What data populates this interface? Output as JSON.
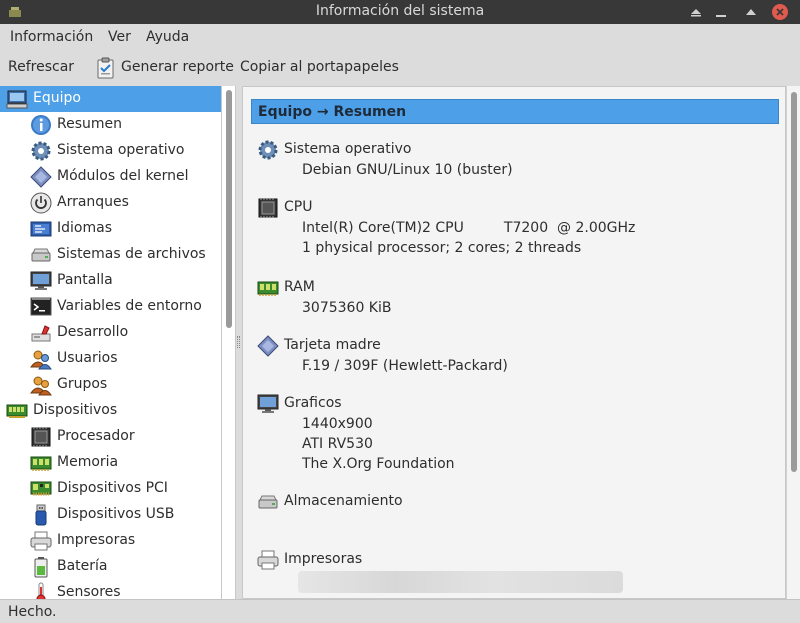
{
  "window": {
    "title": "Información del sistema"
  },
  "menubar": {
    "items": [
      "Información",
      "Ver",
      "Ayuda"
    ]
  },
  "toolbar": {
    "refresh_label": "Refrescar",
    "report_label": "Generar reporte",
    "copy_label": "Copiar al portapapeles"
  },
  "sidebar": {
    "items": [
      {
        "label": "Equipo",
        "icon": "computer-icon",
        "level": 0,
        "selected": true
      },
      {
        "label": "Resumen",
        "icon": "info-icon",
        "level": 1
      },
      {
        "label": "Sistema operativo",
        "icon": "gear-icon",
        "level": 1
      },
      {
        "label": "Módulos del kernel",
        "icon": "kernel-module-icon",
        "level": 1
      },
      {
        "label": "Arranques",
        "icon": "power-icon",
        "level": 1
      },
      {
        "label": "Idiomas",
        "icon": "language-icon",
        "level": 1
      },
      {
        "label": "Sistemas de archivos",
        "icon": "drive-icon",
        "level": 1
      },
      {
        "label": "Pantalla",
        "icon": "monitor-icon",
        "level": 1
      },
      {
        "label": "Variables de entorno",
        "icon": "terminal-icon",
        "level": 1
      },
      {
        "label": "Desarrollo",
        "icon": "development-icon",
        "level": 1
      },
      {
        "label": "Usuarios",
        "icon": "user-icon",
        "level": 1
      },
      {
        "label": "Grupos",
        "icon": "group-icon",
        "level": 1
      },
      {
        "label": "Dispositivos",
        "icon": "devices-icon",
        "level": 0
      },
      {
        "label": "Procesador",
        "icon": "cpu-icon",
        "level": 1
      },
      {
        "label": "Memoria",
        "icon": "memory-icon",
        "level": 1
      },
      {
        "label": "Dispositivos PCI",
        "icon": "pci-icon",
        "level": 1
      },
      {
        "label": "Dispositivos USB",
        "icon": "usb-icon",
        "level": 1
      },
      {
        "label": "Impresoras",
        "icon": "printer-icon",
        "level": 1
      },
      {
        "label": "Batería",
        "icon": "battery-icon",
        "level": 1
      },
      {
        "label": "Sensores",
        "icon": "sensor-icon",
        "level": 1
      }
    ]
  },
  "content": {
    "header": "Equipo → Resumen",
    "sections": [
      {
        "title": "Sistema operativo",
        "icon": "gear-icon",
        "values": [
          "Debian GNU/Linux 10 (buster)"
        ]
      },
      {
        "title": "CPU",
        "icon": "cpu-icon",
        "values": [
          "Intel(R) Core(TM)2 CPU         T7200  @ 2.00GHz",
          "1 physical processor; 2 cores; 2 threads"
        ]
      },
      {
        "title": "RAM",
        "icon": "memory-icon",
        "values": [
          "3075360 KiB"
        ]
      },
      {
        "title": "Tarjeta madre",
        "icon": "motherboard-icon",
        "values": [
          "F.19 / 309F (Hewlett-Packard)"
        ]
      },
      {
        "title": "Graficos",
        "icon": "monitor-icon",
        "values": [
          "1440x900",
          "ATI RV530",
          "The X.Org Foundation"
        ]
      },
      {
        "title": "Almacenamiento",
        "icon": "drive-icon",
        "values": []
      },
      {
        "title": "Impresoras",
        "icon": "printer-icon",
        "values": []
      }
    ]
  },
  "statusbar": {
    "text": "Hecho."
  },
  "colors": {
    "selection": "#4da0e8",
    "titlebar": "#383838",
    "close_button": "#e05a4e"
  }
}
